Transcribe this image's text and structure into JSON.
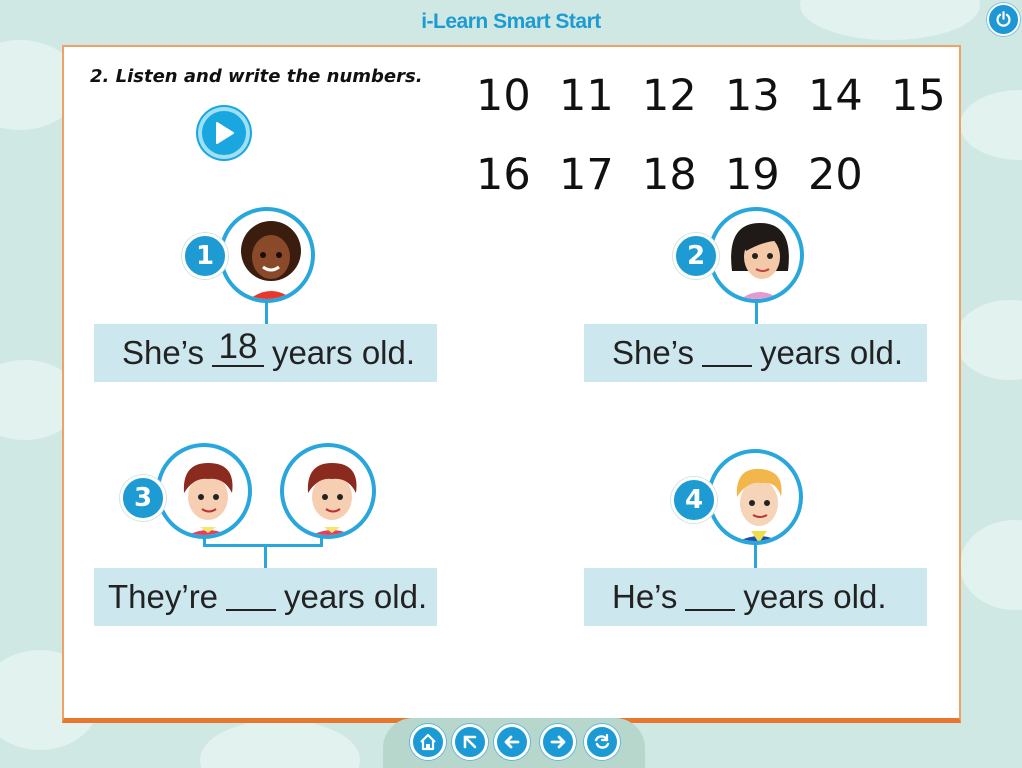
{
  "app": {
    "title": "i-Learn Smart Start"
  },
  "exercise": {
    "title": "2. Listen and write the numbers.",
    "number_bank": {
      "row1": [
        "10",
        "11",
        "12",
        "13",
        "14",
        "15"
      ],
      "row2": [
        "16",
        "17",
        "18",
        "19",
        "20"
      ]
    },
    "items": [
      {
        "badge": "1",
        "before": "She’s",
        "answer": "18",
        "after": "years old."
      },
      {
        "badge": "2",
        "before": "She’s",
        "answer": "",
        "after": "years old."
      },
      {
        "badge": "3",
        "before": "They’re",
        "answer": "",
        "after": "years old."
      },
      {
        "badge": "4",
        "before": "He’s",
        "answer": "",
        "after": "years old."
      }
    ]
  },
  "nav": {
    "buttons": [
      "home-icon",
      "menu-icon",
      "back-icon",
      "next-icon",
      "replay-icon"
    ]
  },
  "colors": {
    "accent": "#1e9bd2",
    "panel_border": "#e8772d",
    "sentence_bg": "#cde7ee",
    "background": "#cfe8e3"
  }
}
